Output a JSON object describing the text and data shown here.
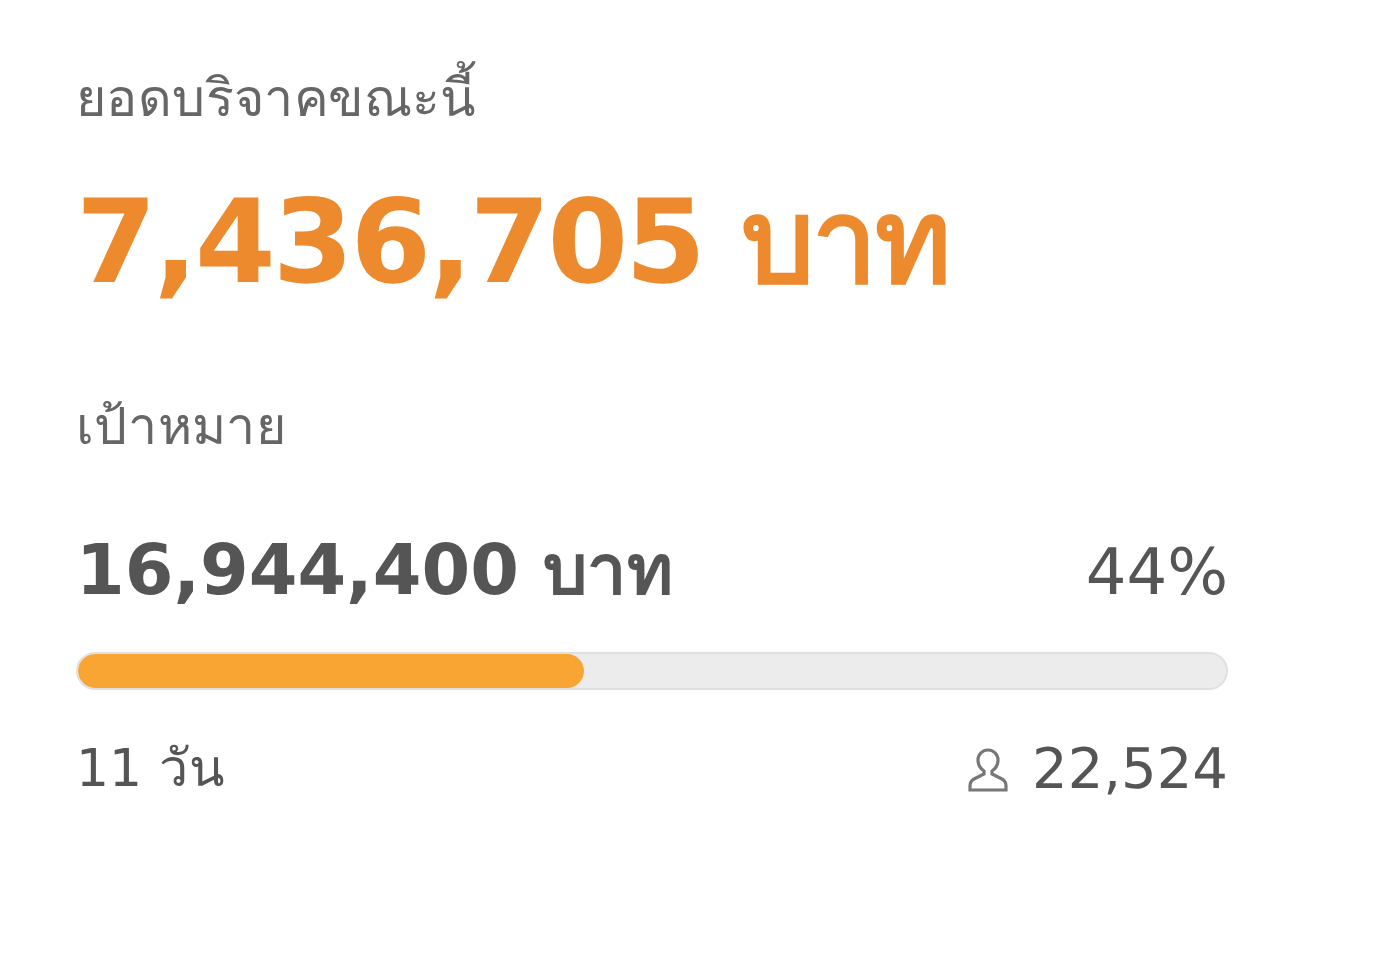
{
  "raised": {
    "label": "ยอดบริจาคขณะนี้",
    "amount": "7,436,705 บาท"
  },
  "goal": {
    "label": "เป้าหมาย",
    "amount": "16,944,400 บาท",
    "percent": "44%",
    "level": 0.44
  },
  "footer": {
    "days": "11 วัน",
    "donors": "22,524"
  }
}
